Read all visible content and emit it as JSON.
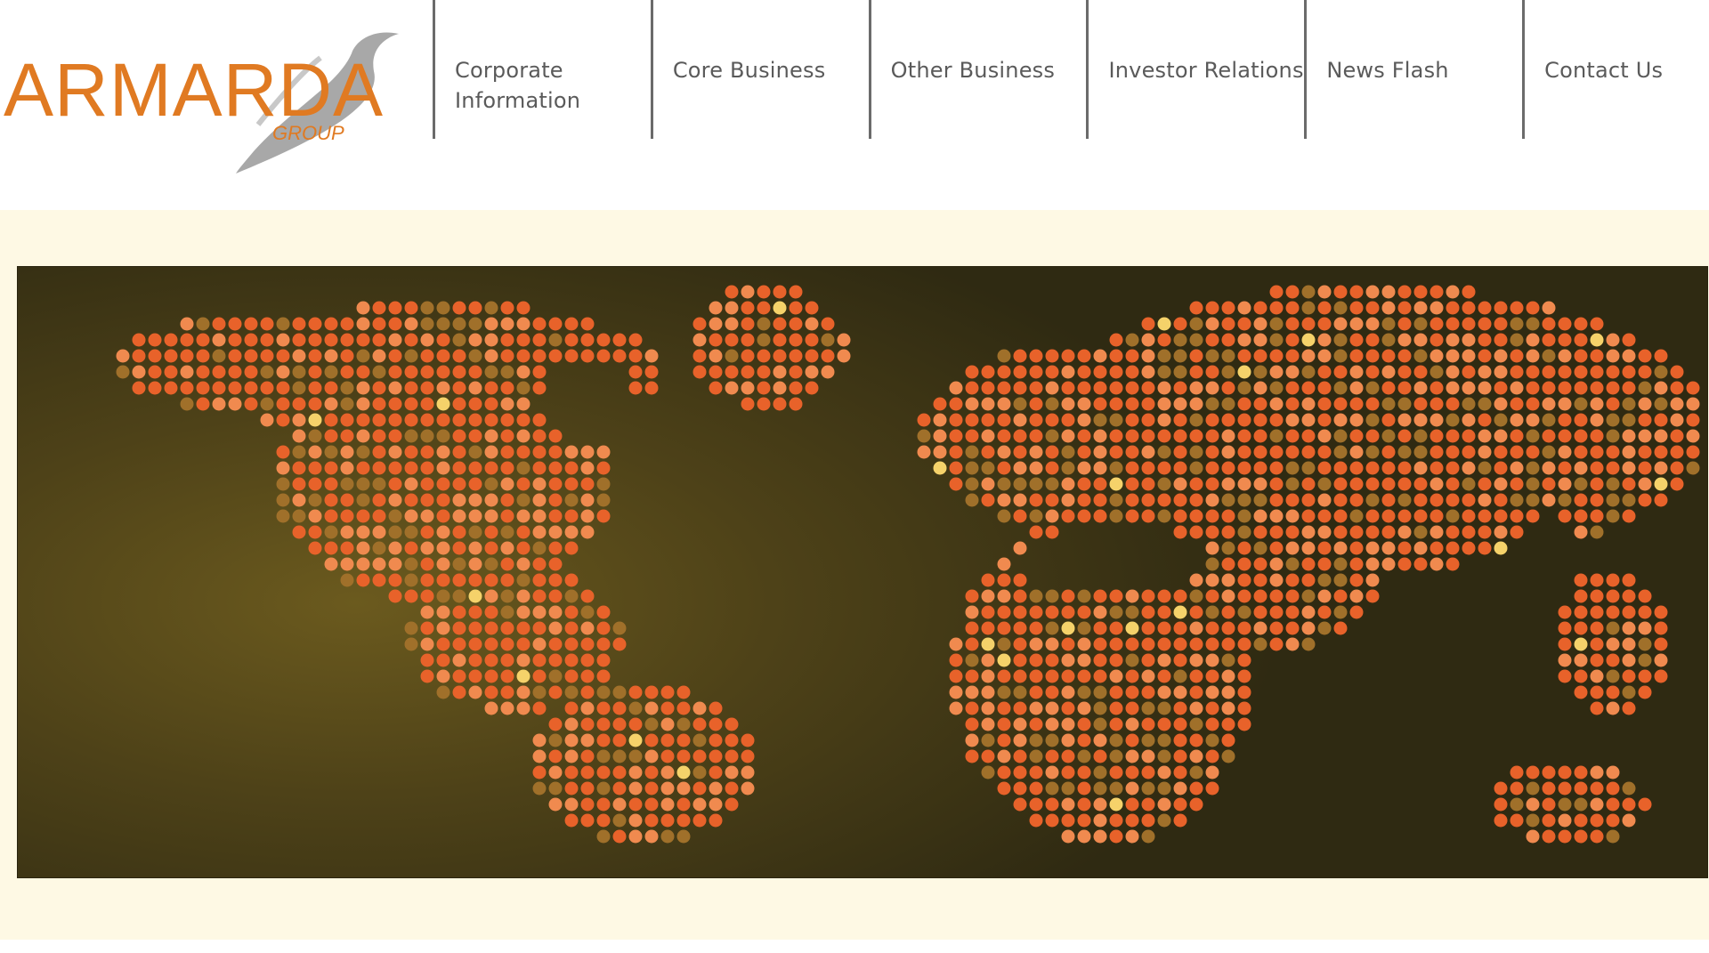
{
  "brand": {
    "name": "ARMARDA",
    "sub": "GROUP",
    "color": "#e07a22",
    "swoosh_color": "#9a9a9a"
  },
  "nav": {
    "items": [
      {
        "label": "Corporate\nInformation"
      },
      {
        "label": "Core Business"
      },
      {
        "label": "Other Business"
      },
      {
        "label": "Investor Relations"
      },
      {
        "label": "News Flash"
      },
      {
        "label": "Contact Us"
      }
    ],
    "divider_color": "#6b6b6b",
    "text_color": "#5a5a5a"
  },
  "banner": {
    "background": "#fef9e4",
    "dot_colors": [
      "#e8622a",
      "#f08a4f",
      "#a0702a",
      "#f5d26a"
    ],
    "image": "world-map-dots"
  }
}
